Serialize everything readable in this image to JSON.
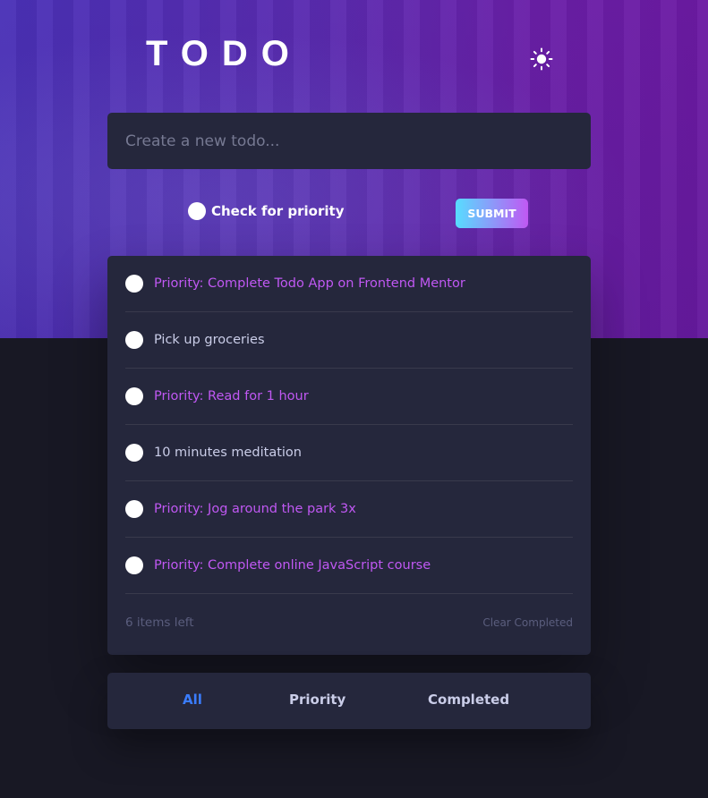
{
  "header": {
    "title": "TODO",
    "theme_icon": "sun-icon"
  },
  "new_todo": {
    "placeholder": "Create a new todo..."
  },
  "priority": {
    "label": "Check for priority"
  },
  "submit": {
    "label": "SUBMIT"
  },
  "todos": [
    {
      "text": "Priority: Complete Todo App on Frontend Mentor",
      "priority": true
    },
    {
      "text": "Pick up groceries",
      "priority": false
    },
    {
      "text": "Priority: Read for 1 hour",
      "priority": true
    },
    {
      "text": "10 minutes meditation",
      "priority": false
    },
    {
      "text": "Priority: Jog around the park 3x",
      "priority": true
    },
    {
      "text": "Priority: Complete online JavaScript course",
      "priority": true
    }
  ],
  "footer": {
    "items_left": "6 items left",
    "clear_completed": "Clear Completed"
  },
  "filters": {
    "all": "All",
    "priority": "Priority",
    "completed": "Completed",
    "active": "All"
  },
  "colors": {
    "accent": "#3a7cfd",
    "priority_text": "#c058f3",
    "card_bg": "#25273c",
    "page_bg": "#181824"
  }
}
